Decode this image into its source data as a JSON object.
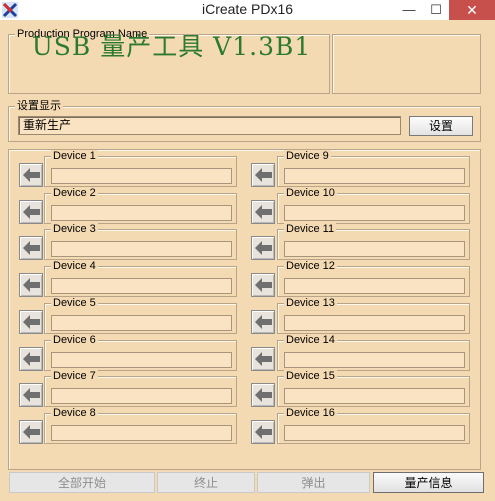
{
  "window": {
    "title": "iCreate PDx16",
    "min_label": "—",
    "max_label": "☐",
    "close_label": "✕"
  },
  "program": {
    "legend": "Production Program Name",
    "name": "USB 量产工具 V1.3B1"
  },
  "setting": {
    "legend": "设置显示",
    "value": "重新生产",
    "button_label": "设置"
  },
  "devices": [
    "Device 1",
    "Device 2",
    "Device 3",
    "Device 4",
    "Device 5",
    "Device 6",
    "Device 7",
    "Device 8",
    "Device 9",
    "Device 10",
    "Device 11",
    "Device 12",
    "Device 13",
    "Device 14",
    "Device 15",
    "Device 16"
  ],
  "bottom": {
    "start_all": "全部开始",
    "stop": "终止",
    "eject": "弹出",
    "info": "量产信息"
  },
  "colors": {
    "background": "#f4dab3",
    "field": "#fae3c2",
    "program_text": "#2c7a32",
    "close": "#c7504d"
  },
  "icons": {
    "app": "usb-tool-icon",
    "device_button": "arrow-left-icon"
  }
}
